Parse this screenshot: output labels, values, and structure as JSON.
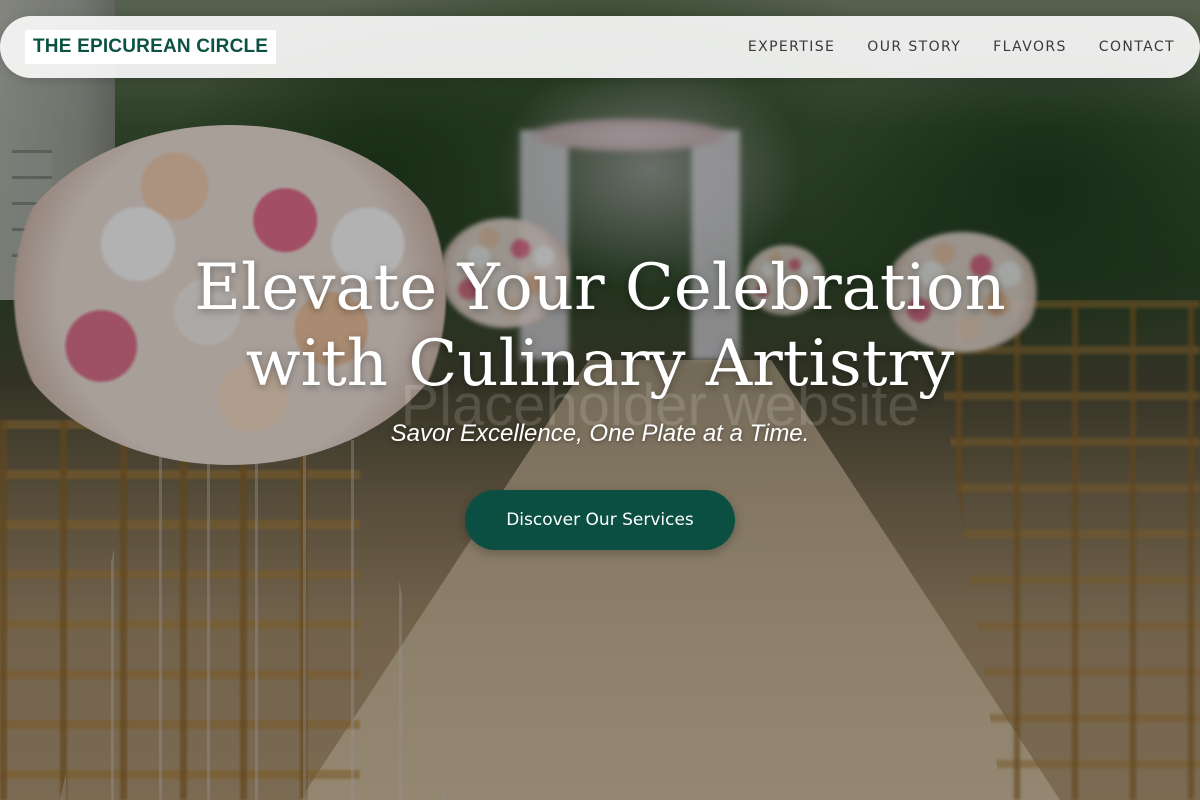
{
  "header": {
    "brand": "THE EPICUREAN CIRCLE",
    "nav": [
      {
        "label": "EXPERTISE"
      },
      {
        "label": "OUR STORY"
      },
      {
        "label": "FLAVORS"
      },
      {
        "label": "CONTACT"
      }
    ]
  },
  "hero": {
    "title_line1": "Elevate Your Celebration",
    "title_line2": "with Culinary Artistry",
    "subtitle": "Savor Excellence, One Plate at a Time.",
    "cta_label": "Discover Our Services",
    "watermark": "Placeholder website",
    "background_image": "outdoor-wedding-aisle-with-flowers"
  },
  "colors": {
    "brand": "#0c5243",
    "cta_background": "#0b4f43",
    "nav_background": "#f8f8f7",
    "hero_text": "#ffffff"
  }
}
